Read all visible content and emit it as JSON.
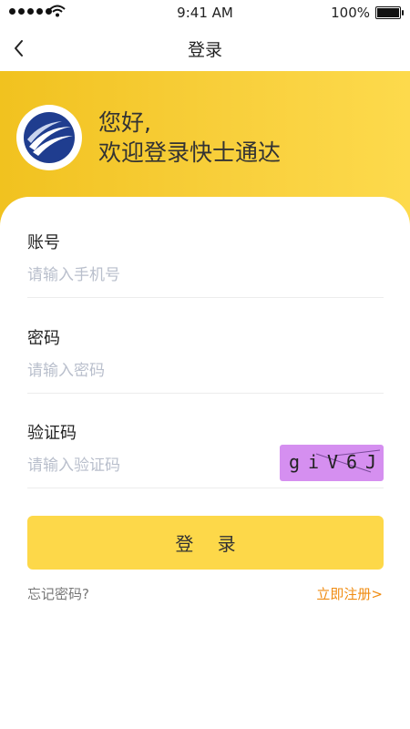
{
  "status_bar": {
    "time": "9:41 AM",
    "battery": "100%"
  },
  "nav": {
    "title": "登录"
  },
  "hero": {
    "greeting_line1": "您好,",
    "greeting_line2": "欢迎登录快士通达"
  },
  "form": {
    "account_label": "账号",
    "account_placeholder": "请输入手机号",
    "password_label": "密码",
    "password_placeholder": "请输入密码",
    "captcha_label": "验证码",
    "captcha_placeholder": "请输入验证码",
    "captcha_text": "giV6J"
  },
  "actions": {
    "login_label": "登 录",
    "forgot_label": "忘记密码?",
    "register_label": "立即注册>"
  },
  "colors": {
    "brand_yellow": "#fdd849",
    "link_orange": "#f08c12",
    "captcha_bg": "#d58ff0"
  }
}
